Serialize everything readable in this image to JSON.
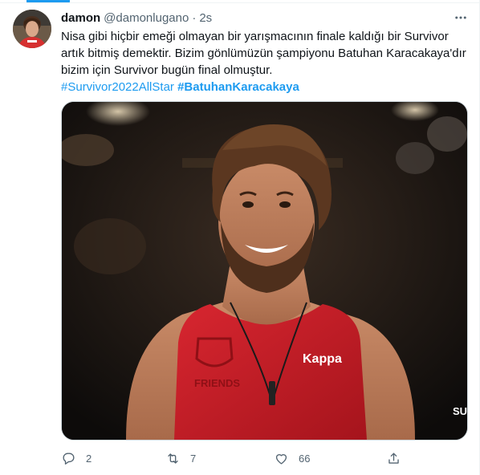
{
  "tweet": {
    "display_name": "damon",
    "handle": "@damonlugano",
    "separator": "·",
    "time": "2s",
    "text_line_1": "Nisa gibi hiçbir emeği olmayan bir yarışmacının finale kaldığı bir Survivor",
    "text_line_2": "artık bitmiş demektir. Bizim gönlümüzün şampiyonu Batuhan Karacakaya'dır",
    "text_line_3": "bizim için Survivor bugün final olmuştur.",
    "hashtag_1": "#Survivor2022AllStar",
    "hashtag_2": "#BatuhanKaracakaya",
    "media": {
      "jersey_text": "FRIENDS",
      "brand_text": "Kappa",
      "corner_text": "SU"
    }
  },
  "actions": {
    "reply_count": "2",
    "retweet_count": "7",
    "like_count": "66",
    "share_count": ""
  },
  "icons": {
    "more": "more-icon",
    "reply": "reply-icon",
    "retweet": "retweet-icon",
    "like": "heart-icon",
    "share": "share-icon"
  },
  "colors": {
    "accent": "#1d9bf0",
    "text_secondary": "#536471",
    "jersey_red": "#d3202a"
  }
}
